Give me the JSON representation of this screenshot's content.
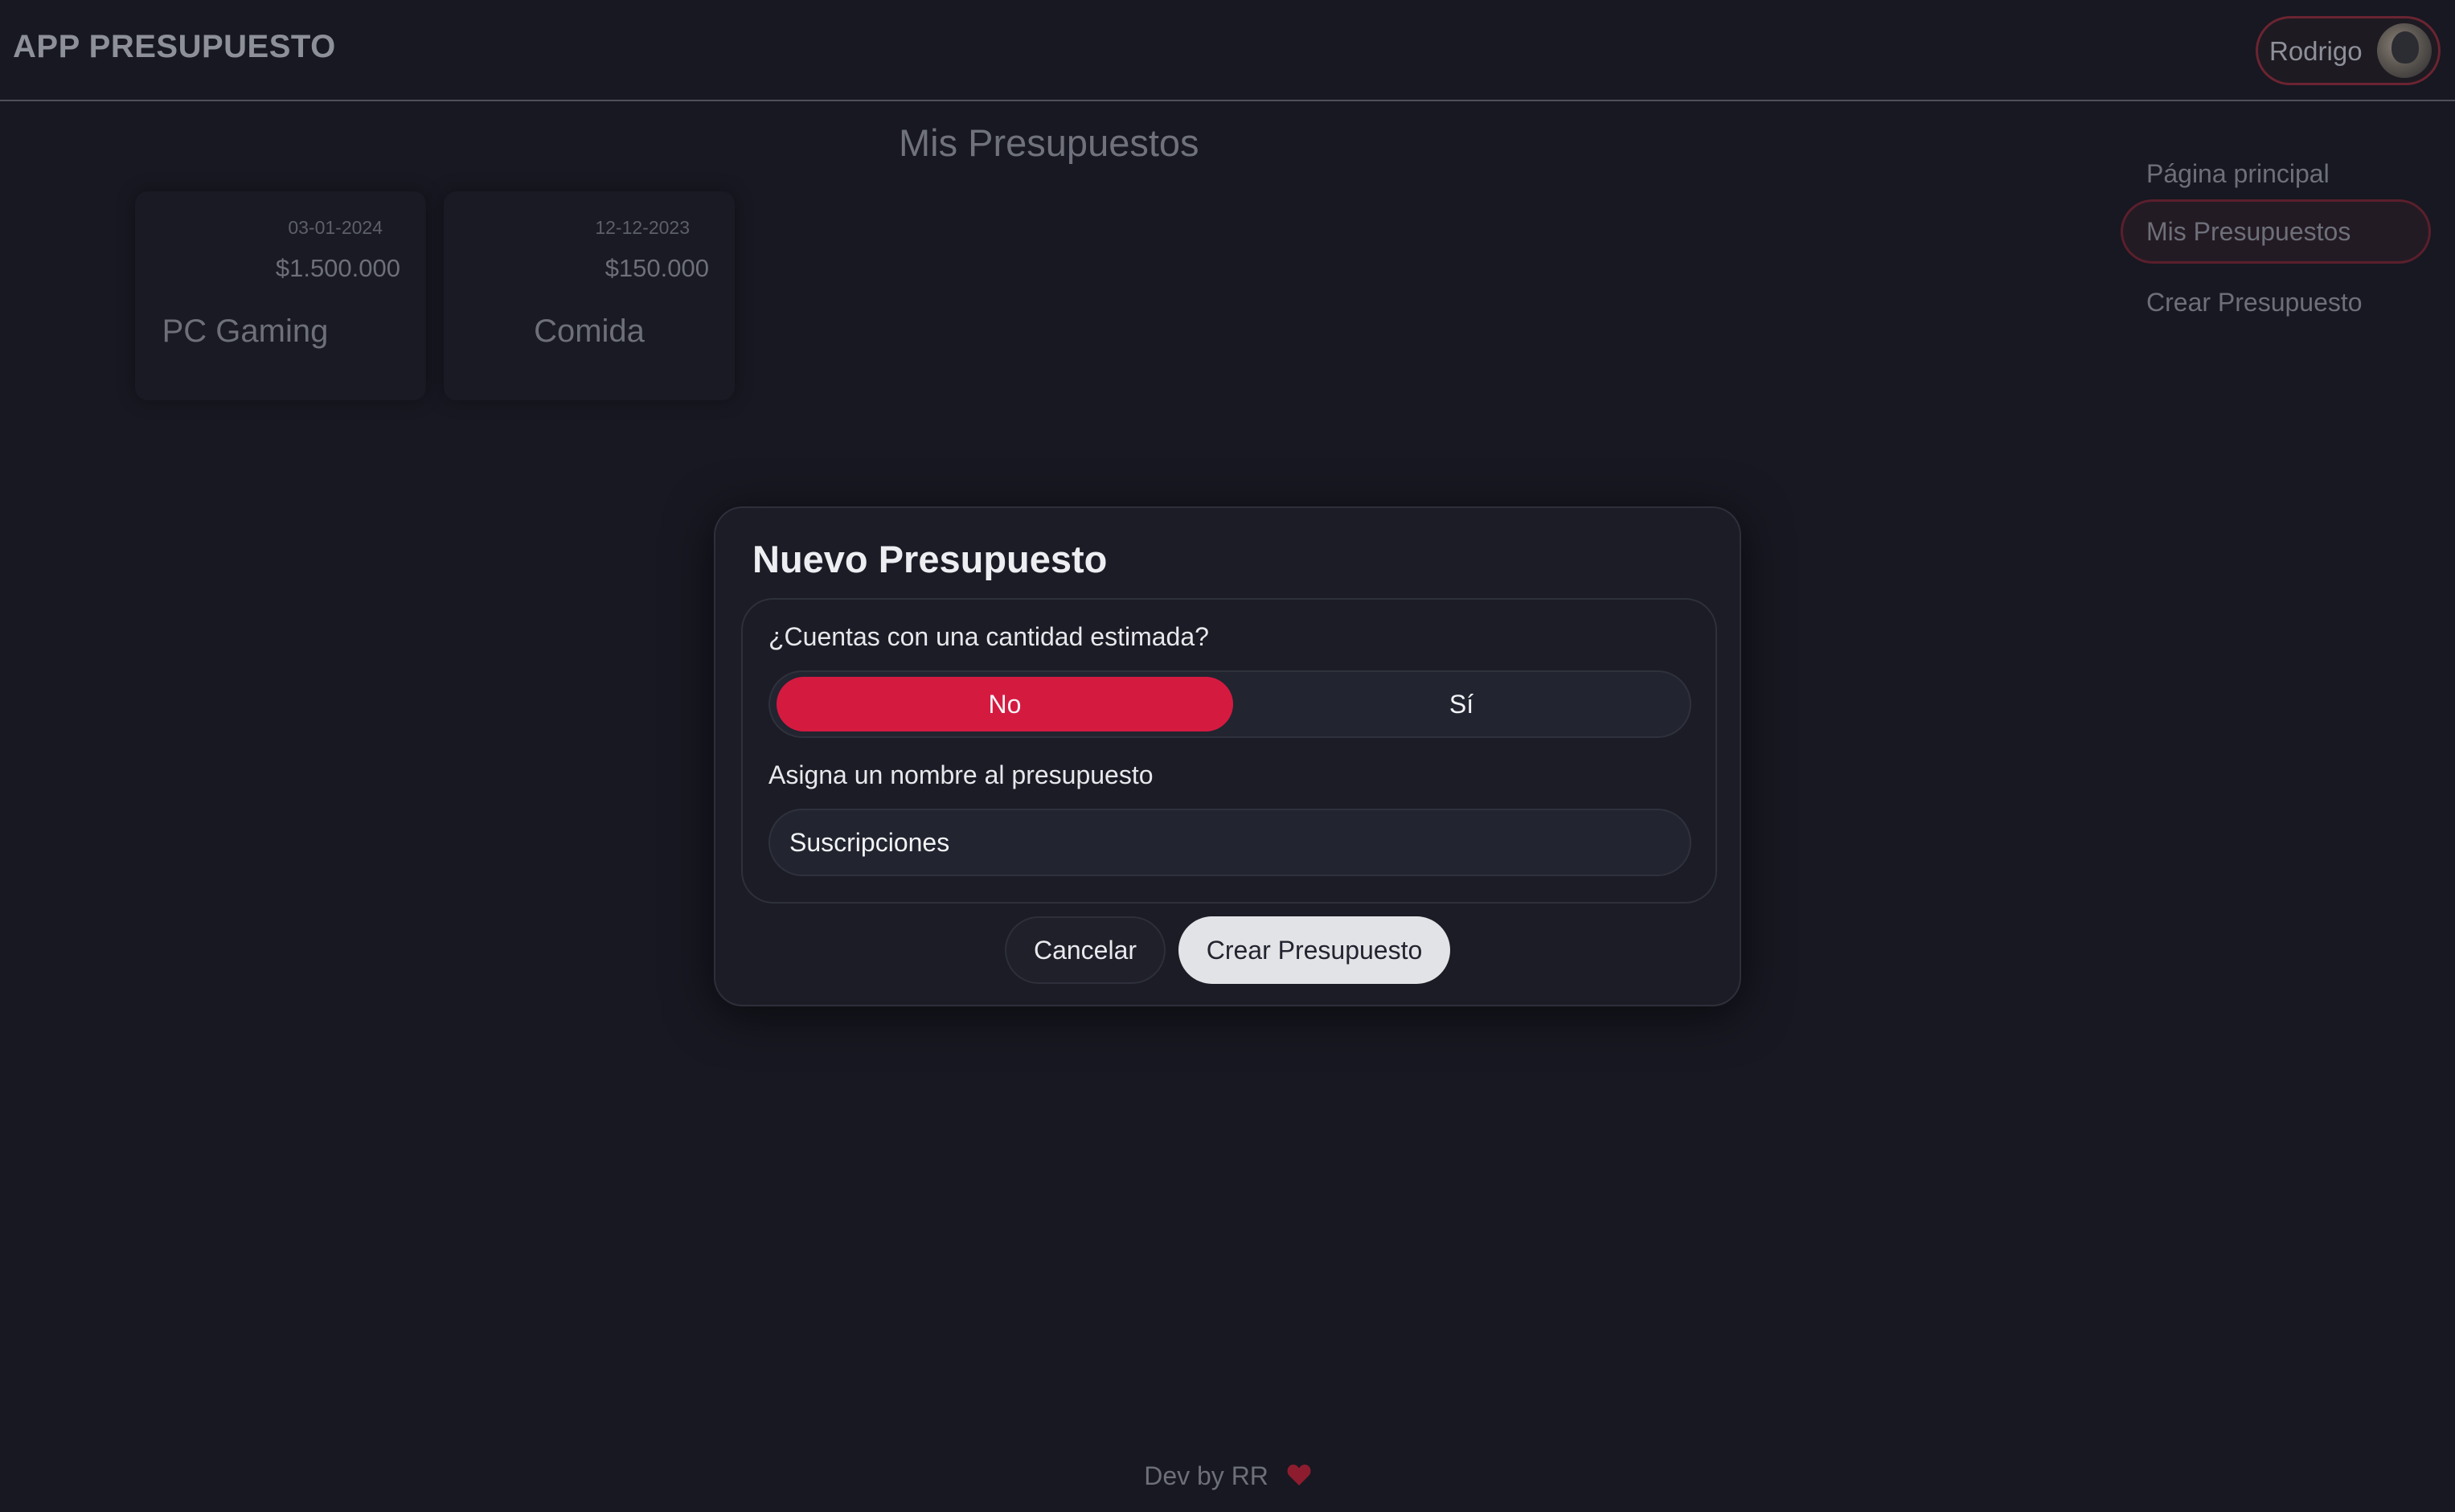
{
  "header": {
    "app_title": "APP PRESUPUESTO",
    "user_name": "Rodrigo"
  },
  "main": {
    "heading": "Mis Presupuestos",
    "cards": [
      {
        "date": "03-01-2024",
        "amount": "$1.500.000",
        "name": "PC Gaming"
      },
      {
        "date": "12-12-2023",
        "amount": "$150.000",
        "name": "Comida"
      }
    ]
  },
  "nav": {
    "items": [
      {
        "label": "Página principal",
        "active": false
      },
      {
        "label": "Mis Presupuestos",
        "active": true
      },
      {
        "label": "Crear Presupuesto",
        "active": false
      }
    ]
  },
  "footer": {
    "text": "Dev by RR"
  },
  "modal": {
    "title": "Nuevo Presupuesto",
    "estimate_question": "¿Cuentas con una cantidad estimada?",
    "toggle_options": [
      "No",
      "Sí"
    ],
    "toggle_selected": "No",
    "name_label": "Asigna un nombre al presupuesto",
    "name_value": "Suscripciones",
    "cancel_label": "Cancelar",
    "create_label": "Crear Presupuesto"
  },
  "colors": {
    "background": "#171821",
    "accent": "#d51a40",
    "modal_bg": "#1b1c25",
    "primary_button": "#e2e3e6"
  },
  "icons": {
    "avatar": "user-avatar",
    "footer_heart": "heart-icon"
  }
}
